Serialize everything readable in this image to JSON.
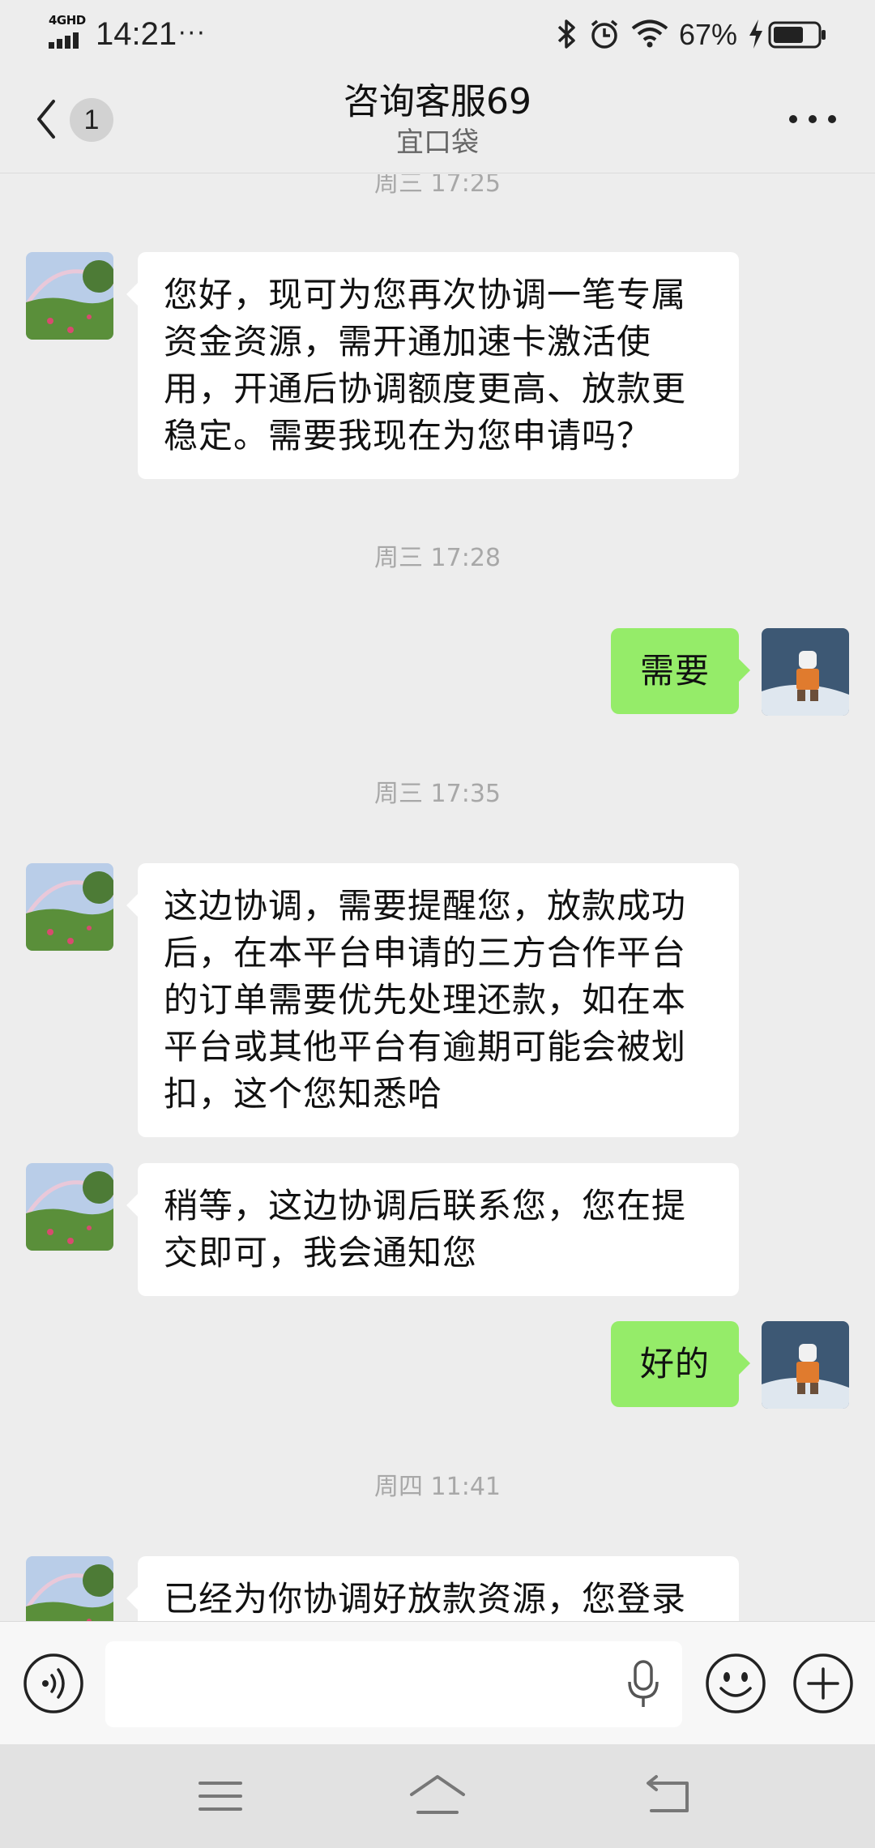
{
  "status_bar": {
    "network": "4GHD",
    "time": "14:21",
    "more_indicator": "···",
    "battery_percent": "67%",
    "icons": [
      "bluetooth-icon",
      "alarm-icon",
      "wifi-icon",
      "charging-icon",
      "battery-icon"
    ]
  },
  "header": {
    "back_icon": "chevron-left-icon",
    "unread_badge": "1",
    "title": "咨询客服69",
    "subtitle": "宜口袋",
    "more_icon": "more-dots-icon"
  },
  "messages": [
    {
      "type": "timestamp",
      "text": "周三 17:25"
    },
    {
      "type": "message",
      "side": "left",
      "text": "您好，现可为您再次协调一笔专属资金资源，需开通加速卡激活使用，开通后协调额度更高、放款更稳定。需要我现在为您申请吗？"
    },
    {
      "type": "timestamp",
      "text": "周三 17:28"
    },
    {
      "type": "message",
      "side": "right",
      "text": "需要"
    },
    {
      "type": "timestamp",
      "text": "周三 17:35"
    },
    {
      "type": "message",
      "side": "left",
      "text": "这边协调，需要提醒您，放款成功后，在本平台申请的三方合作平台的订单需要优先处理还款，如在本平台或其他平台有逾期可能会被划扣，这个您知悉哈"
    },
    {
      "type": "message",
      "side": "left",
      "text": "稍等，这边协调后联系您，您在提交即可，我会通知您"
    },
    {
      "type": "message",
      "side": "right",
      "text": "好的"
    },
    {
      "type": "timestamp",
      "text": "周四 11:41"
    },
    {
      "type": "message",
      "side": "left",
      "text": "已经为你协调好放款资源，您登录"
    }
  ],
  "input_bar": {
    "voice_icon": "voice-icon",
    "text_value": "",
    "mic_icon": "microphone-icon",
    "emoji_icon": "emoji-icon",
    "plus_icon": "plus-icon"
  },
  "system_nav": {
    "icons": [
      "menu-icon",
      "home-icon",
      "back-icon"
    ]
  },
  "colors": {
    "background": "#ededed",
    "bubble_incoming": "#ffffff",
    "bubble_outgoing": "#95ec69",
    "timestamp_text": "#a8a8a8"
  }
}
